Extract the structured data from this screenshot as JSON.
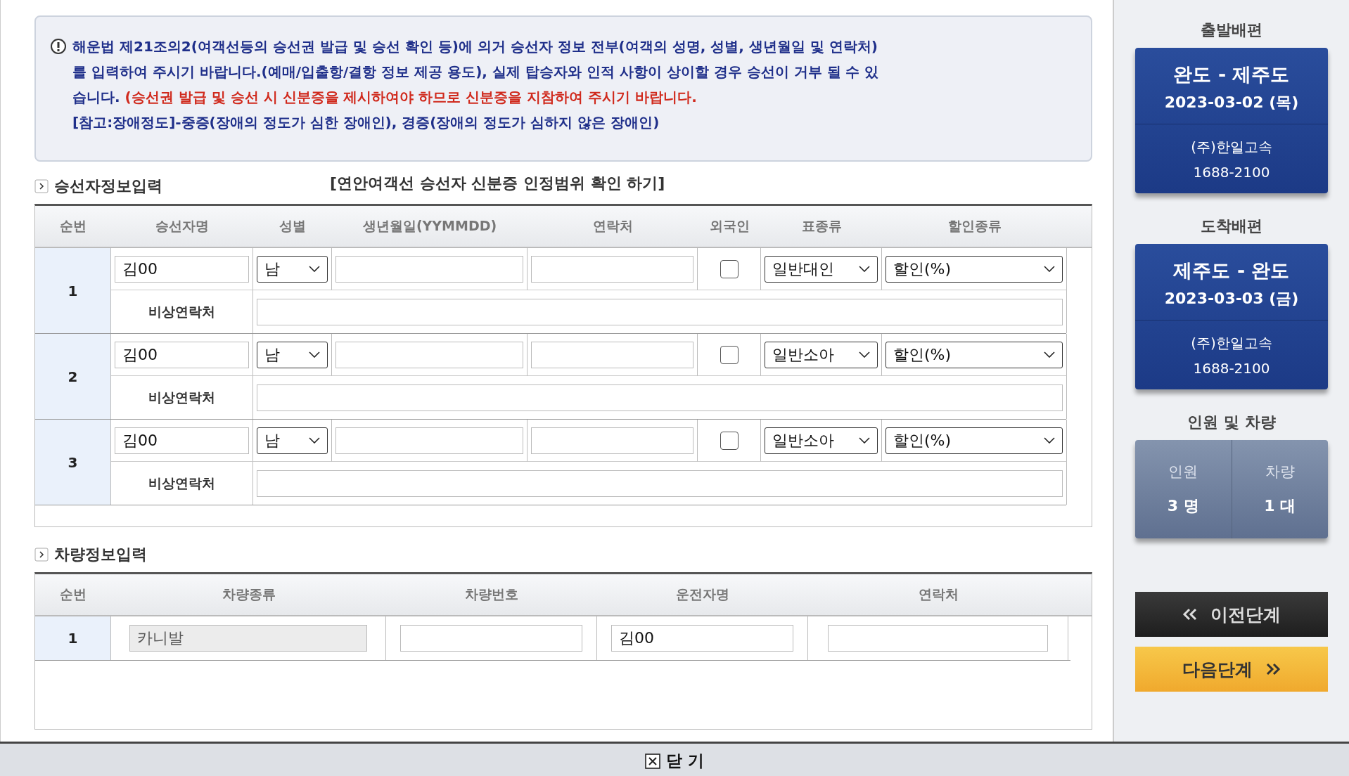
{
  "notice": {
    "main": [
      {
        "kind": "normal",
        "text": "해운법 제21조의2(여객선등의 승선권 발급 및 승선 확인 등)에 의거 승선자 정보 전부(여객의 성명, 성별, 생년월일 및 연락처)를 입력하여 주시기 바랍니다.(예매/입출항/결항 정보 제공 용도), 실제 탑승자와 인적 사항이 상이할 경우 승선이 거부 될 수 있습니다. "
      },
      {
        "kind": "warning",
        "text": "(승선권 발급 및 승선 시 신분증을 제시하여야 하므로 신분증을 지참하여 주시기 바랍니다."
      }
    ],
    "note": "[참고:장애정도]-중증(장애의 정도가 심한 장애인), 경증(장애의 정도가 심하지 않은 장애인)"
  },
  "passenger_section": {
    "title": "승선자정보입력",
    "id_link": "[연안여객선 승선자 신분증 인정범위 확인 하기]",
    "columns": [
      "순번",
      "승선자명",
      "성별",
      "생년월일(YYMMDD)",
      "연락처",
      "외국인",
      "표종류",
      "할인종류"
    ],
    "rows": [
      {
        "no": "1",
        "name": "김00",
        "gender": "남",
        "foreigner": false,
        "ticket_type": "일반대인",
        "discount": "할인(%)",
        "emergency_label": "비상연락처"
      },
      {
        "no": "2",
        "name": "김00",
        "gender": "남",
        "foreigner": false,
        "ticket_type": "일반소아",
        "discount": "할인(%)",
        "emergency_label": "비상연락처"
      },
      {
        "no": "3",
        "name": "김00",
        "gender": "남",
        "foreigner": false,
        "ticket_type": "일반소아",
        "discount": "할인(%)",
        "emergency_label": "비상연락처"
      }
    ]
  },
  "vehicle_section": {
    "title": "차량정보입력",
    "columns": [
      "순번",
      "차량종류",
      "차량번호",
      "운전자명",
      "연락처"
    ],
    "rows": [
      {
        "no": "1",
        "type": "카니발",
        "driver": "김00"
      }
    ]
  },
  "sidebar": {
    "departure": {
      "heading": "출발배편",
      "route": "완도 - 제주도",
      "date": "2023-03-02 (목)",
      "company": "(주)한일고속",
      "phone": "1688-2100"
    },
    "arrival": {
      "heading": "도착배편",
      "route": "제주도 - 완도",
      "date": "2023-03-03 (금)",
      "company": "(주)한일고속",
      "phone": "1688-2100"
    },
    "summary": {
      "heading": "인원 및 차량",
      "items": [
        {
          "label": "인원",
          "value": "3 명"
        },
        {
          "label": "차량",
          "value": "1 대"
        }
      ]
    },
    "prev_button": "이전단계",
    "next_button": "다음단계"
  },
  "close_button": "닫 기"
}
